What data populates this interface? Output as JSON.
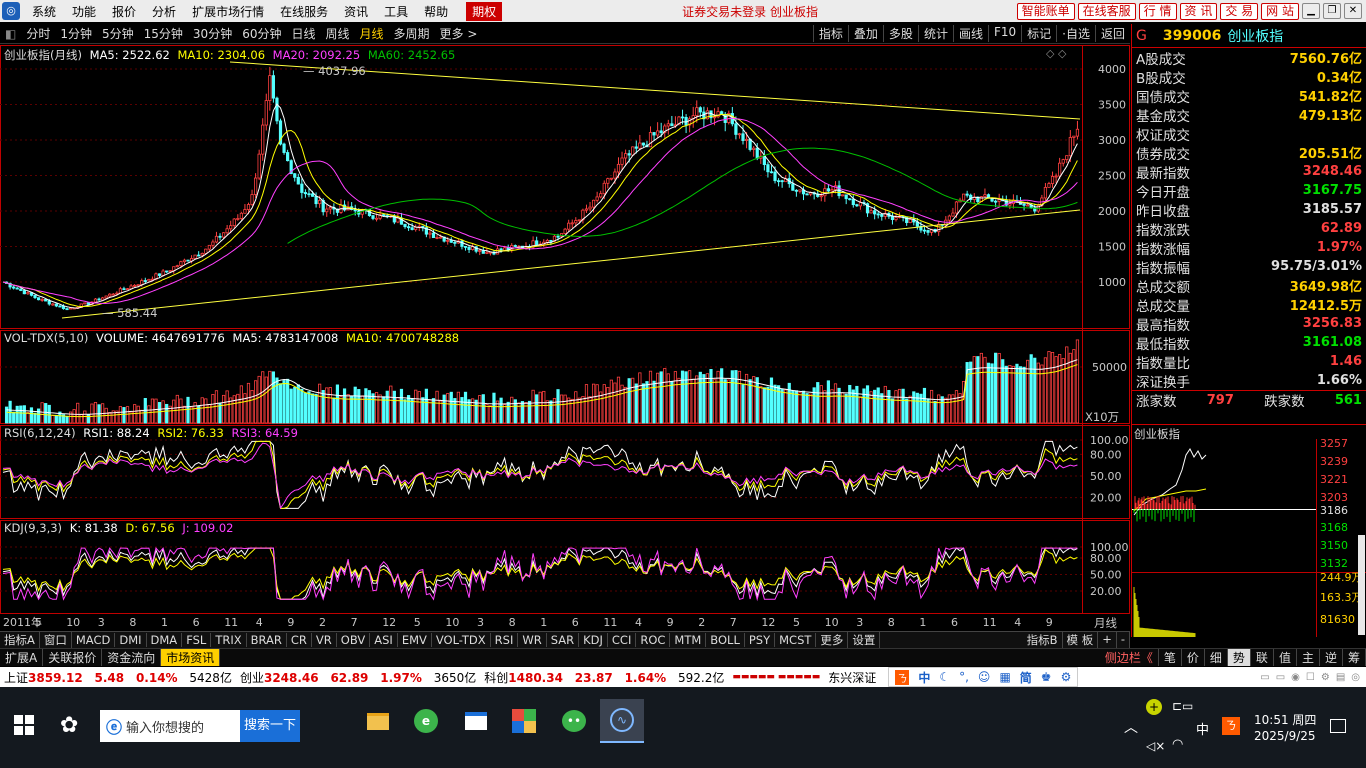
{
  "menu": {
    "items": [
      "系统",
      "功能",
      "报价",
      "分析",
      "扩展市场行情",
      "在线服务",
      "资讯",
      "工具",
      "帮助"
    ],
    "qh": "期权",
    "notice": "证券交易未登录 创业板指",
    "right_buttons": [
      "智能账单",
      "在线客服",
      "行 情",
      "资 讯",
      "交 易",
      "网 站"
    ]
  },
  "toolbar": {
    "items": [
      "分时",
      "1分钟",
      "5分钟",
      "15分钟",
      "30分钟",
      "60分钟",
      "日线",
      "周线",
      "月线",
      "多周期",
      "更多 >"
    ],
    "active": "月线",
    "right": [
      "指标",
      "叠加",
      "多股",
      "统计",
      "画线",
      "F10",
      "标记",
      "·自选",
      "返回"
    ]
  },
  "main_header": {
    "name": "创业板指(月线)",
    "ma5": "MA5: 2522.62",
    "ma10": "MA10: 2304.06",
    "ma20": "MA20: 2092.25",
    "ma60": "MA60: 2452.65",
    "high_label": "4037.96",
    "low_label": "585.44"
  },
  "vol_header": {
    "name": "VOL-TDX(5,10)",
    "volume": "VOLUME: 4647691776",
    "ma5": "MA5: 4783147008",
    "ma10": "MA10: 4700748288",
    "unit": "X10万"
  },
  "rsi_header": {
    "name": "RSI(6,12,24)",
    "rsi1": "RSI1: 88.24",
    "rsi2": "RSI2: 76.33",
    "rsi3": "RSI3: 64.59"
  },
  "kdj_header": {
    "name": "KDJ(9,3,3)",
    "k": "K: 81.38",
    "d": "D: 67.56",
    "j": "J: 109.02"
  },
  "price_axis": [
    "4000",
    "3500",
    "3000",
    "2500",
    "2000",
    "1500",
    "1000"
  ],
  "vol_axis": [
    "50000"
  ],
  "rsi_axis": [
    "100.00",
    "80.00",
    "50.00",
    "20.00"
  ],
  "kdj_axis": [
    "100.00",
    "80.00",
    "50.00",
    "20.00"
  ],
  "time_axis": [
    "2011年",
    "5",
    "10",
    "3",
    "8",
    "1",
    "6",
    "11",
    "4",
    "9",
    "2",
    "7",
    "12",
    "5",
    "10",
    "3",
    "8",
    "1",
    "6",
    "11",
    "4",
    "9",
    "2",
    "7",
    "12",
    "5",
    "10",
    "3",
    "8",
    "1",
    "6",
    "11",
    "4",
    "9"
  ],
  "period_label": "月线",
  "quote": {
    "code": "399006",
    "name": "创业板指",
    "g": "G",
    "rows": [
      {
        "k": "A股成交",
        "v": "7560.76亿",
        "c": "#ffd000"
      },
      {
        "k": "B股成交",
        "v": "0.34亿",
        "c": "#ffd000"
      },
      {
        "k": "国债成交",
        "v": "541.82亿",
        "c": "#ffd000"
      },
      {
        "k": "基金成交",
        "v": "479.13亿",
        "c": "#ffd000"
      },
      {
        "k": "权证成交",
        "v": "",
        "c": "#ffd000"
      },
      {
        "k": "债券成交",
        "v": "205.51亿",
        "c": "#ffd000"
      },
      {
        "k": "最新指数",
        "v": "3248.46",
        "c": "#ff4040"
      },
      {
        "k": "今日开盘",
        "v": "3167.75",
        "c": "#00e000"
      },
      {
        "k": "昨日收盘",
        "v": "3185.57",
        "c": "#e0e0e0"
      },
      {
        "k": "指数涨跌",
        "v": "62.89",
        "c": "#ff4040"
      },
      {
        "k": "指数涨幅",
        "v": "1.97%",
        "c": "#ff4040"
      },
      {
        "k": "指数振幅",
        "v": "95.75/3.01%",
        "c": "#e0e0e0"
      },
      {
        "k": "总成交额",
        "v": "3649.98亿",
        "c": "#ffd000"
      },
      {
        "k": "总成交量",
        "v": "12412.5万",
        "c": "#ffd000"
      },
      {
        "k": "最高指数",
        "v": "3256.83",
        "c": "#ff4040"
      },
      {
        "k": "最低指数",
        "v": "3161.08",
        "c": "#00e000"
      },
      {
        "k": "指数量比",
        "v": "1.46",
        "c": "#ff4040"
      },
      {
        "k": "深证换手",
        "v": "1.66%",
        "c": "#e0e0e0"
      }
    ],
    "up_label": "涨家数",
    "up": "797",
    "down_label": "跌家数",
    "down": "561"
  },
  "mini": {
    "title": "创业板指",
    "axis": [
      "3257",
      "3239",
      "3221",
      "3203",
      "3186",
      "3168",
      "3150",
      "3132",
      "244.9万",
      "163.3万",
      "81630"
    ]
  },
  "tabs": [
    "指标A",
    "窗口",
    "MACD",
    "DMI",
    "DMA",
    "FSL",
    "TRIX",
    "BRAR",
    "CR",
    "VR",
    "OBV",
    "ASI",
    "EMV",
    "VOL-TDX",
    "RSI",
    "WR",
    "SAR",
    "KDJ",
    "CCI",
    "ROC",
    "MTM",
    "BOLL",
    "PSY",
    "MCST",
    "更多",
    "设置"
  ],
  "tabs_right": [
    "指标B",
    "模 板",
    "+",
    "-"
  ],
  "tabs2": [
    "扩展A",
    "关联报价",
    "资金流向",
    "市场资讯"
  ],
  "tabs2_active": "市场资讯",
  "tabs2_right": [
    "侧边栏《",
    "笔",
    "价",
    "细",
    "势",
    "联",
    "值",
    "主",
    "逆",
    "筹"
  ],
  "ticker": {
    "sh": {
      "name": "上证",
      "price": "3859.12",
      "chg": "5.48",
      "pct": "0.14%",
      "amt": "5428亿"
    },
    "cy": {
      "name": "创业",
      "price": "3248.46",
      "chg": "62.89",
      "pct": "1.97%",
      "amt": "3650亿"
    },
    "kc": {
      "name": "科创",
      "price": "1480.34",
      "chg": "23.87",
      "pct": "1.64%",
      "amt": "592.2亿"
    },
    "scroll": "东兴深证"
  },
  "ime": [
    "中",
    "简"
  ],
  "taskbar": {
    "search_placeholder": "输入你想搜的",
    "search_button": "搜索一下",
    "lang": "中",
    "time": "10:51 周四",
    "date": "2025/9/25"
  },
  "colors": {
    "up": "#ff4040",
    "down": "#54ffff",
    "ma5": "#ffffff",
    "ma10": "#ffff00",
    "ma20": "#ff40ff",
    "ma60": "#00c000",
    "red_line": "#c00000"
  }
}
